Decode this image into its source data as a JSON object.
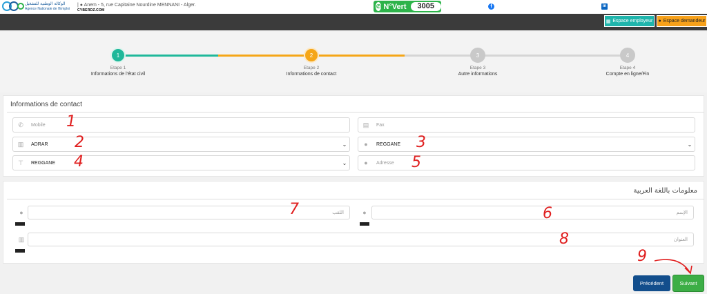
{
  "header": {
    "logo_arabic": "الوكالة الوطنية للتشغيل",
    "logo_french": "Agence Nationale de l'Emploi",
    "address": "Anem - 5, rue Capitaine Nourdine MENNANI - Alger.",
    "watermark": "CYBERDZ.COM",
    "nvert_label": "N°Vert",
    "nvert_number": "3005",
    "facebook_icon": "f",
    "linkedin_icon": "in"
  },
  "nav": {
    "employer_button": "Espace employeur",
    "applicant_button": "Espace demandeur"
  },
  "steps": [
    {
      "number": "1",
      "label": "Etape 1",
      "title": "Informations de l'état civil",
      "color": "#1fb89a"
    },
    {
      "number": "2",
      "label": "Etape 2",
      "title": "Informations de contact",
      "color": "#f5a617"
    },
    {
      "number": "3",
      "label": "Etape 3",
      "title": "Autre informations",
      "color": "#c9c9c9"
    },
    {
      "number": "4",
      "label": "Etape 4",
      "title": "Compte en ligne/Fin",
      "color": "#c9c9c9"
    }
  ],
  "contact": {
    "title": "Informations de contact",
    "mobile_placeholder": "Mobile",
    "fax_placeholder": "Fax",
    "wilaya_value": "ADRAR",
    "commune_value": "REGGANE",
    "daira_value": "REGGANE",
    "adresse_placeholder": "Adresse"
  },
  "arabic": {
    "title": "معلومات باللغة العربية",
    "nom_placeholder": "اللقب",
    "prenom_placeholder": "الإسم",
    "adresse_placeholder": "العنوان"
  },
  "actions": {
    "previous": "Précédent",
    "next": "Suivant"
  },
  "annotations": [
    "1",
    "2",
    "3",
    "4",
    "5",
    "6",
    "7",
    "8",
    "9"
  ]
}
